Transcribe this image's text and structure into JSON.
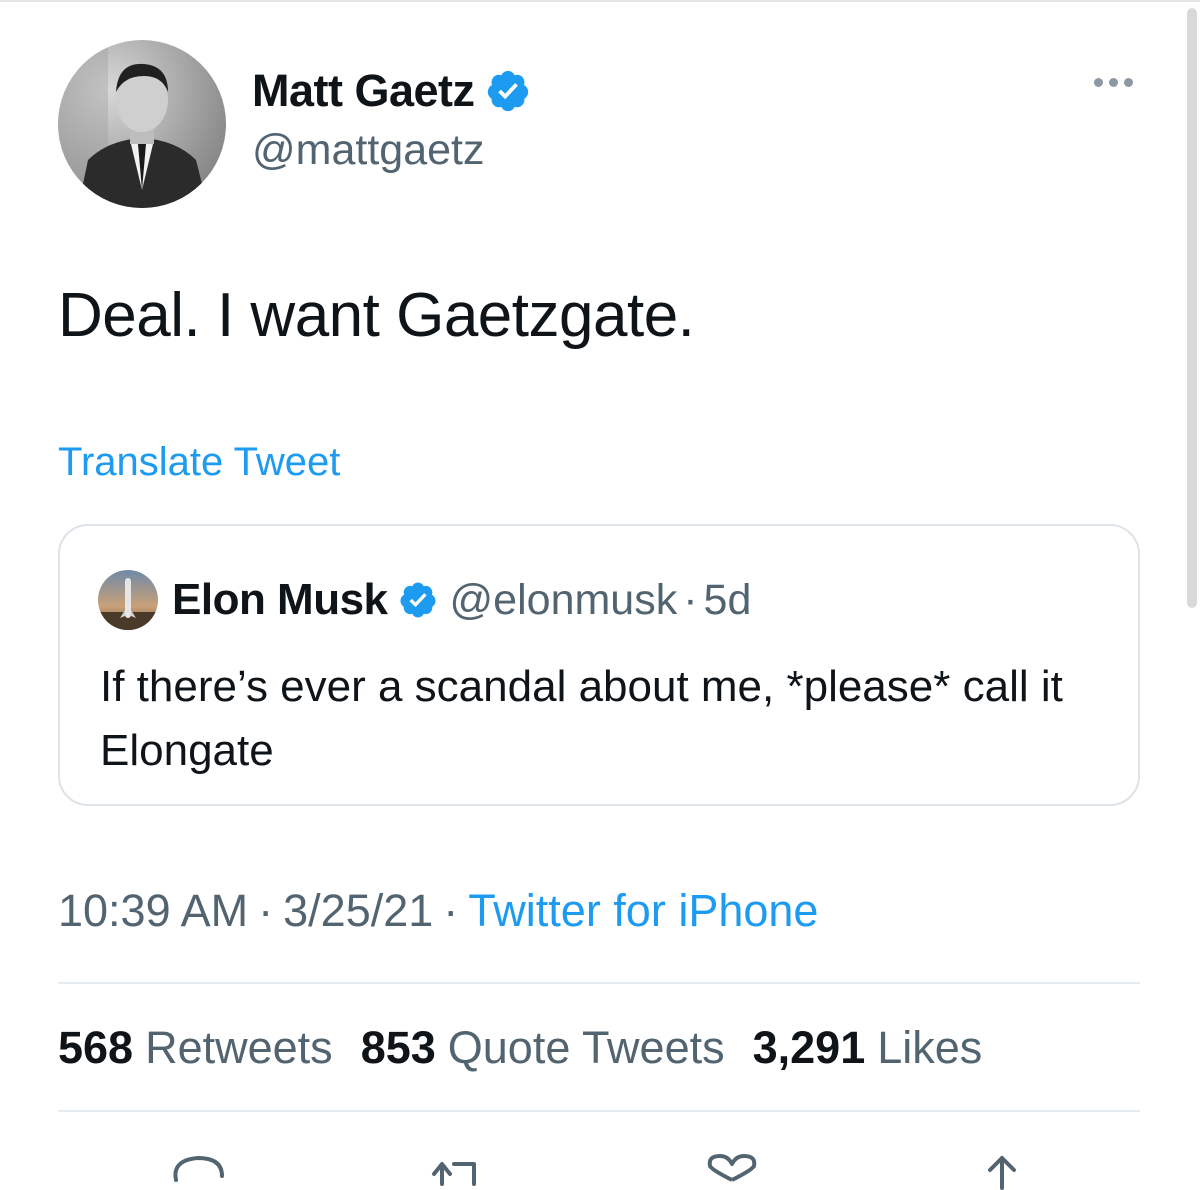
{
  "author": {
    "display_name": "Matt Gaetz",
    "handle": "@mattgaetz",
    "verified": true,
    "avatar_icon": "profile-photo"
  },
  "tweet": {
    "text": "Deal. I want Gaetzgate.",
    "translate_label": "Translate Tweet"
  },
  "quoted_tweet": {
    "display_name": "Elon Musk",
    "handle": "@elonmusk",
    "separator": "·",
    "time": "5d",
    "verified": true,
    "text": "If there’s ever a scandal about me, *please* call it Elongate"
  },
  "meta": {
    "time": "10:39 AM",
    "separator": "·",
    "date": "3/25/21",
    "source": "Twitter for iPhone"
  },
  "stats": [
    {
      "count": "568",
      "label": "Retweets"
    },
    {
      "count": "853",
      "label": "Quote Tweets"
    },
    {
      "count": "3,291",
      "label": "Likes"
    }
  ],
  "actions": [
    "reply-icon",
    "retweet-icon",
    "like-icon",
    "share-icon"
  ],
  "colors": {
    "accent": "#1d9bf0",
    "text_primary": "#0f1419",
    "text_secondary": "#536471",
    "border": "#dde3e8"
  }
}
